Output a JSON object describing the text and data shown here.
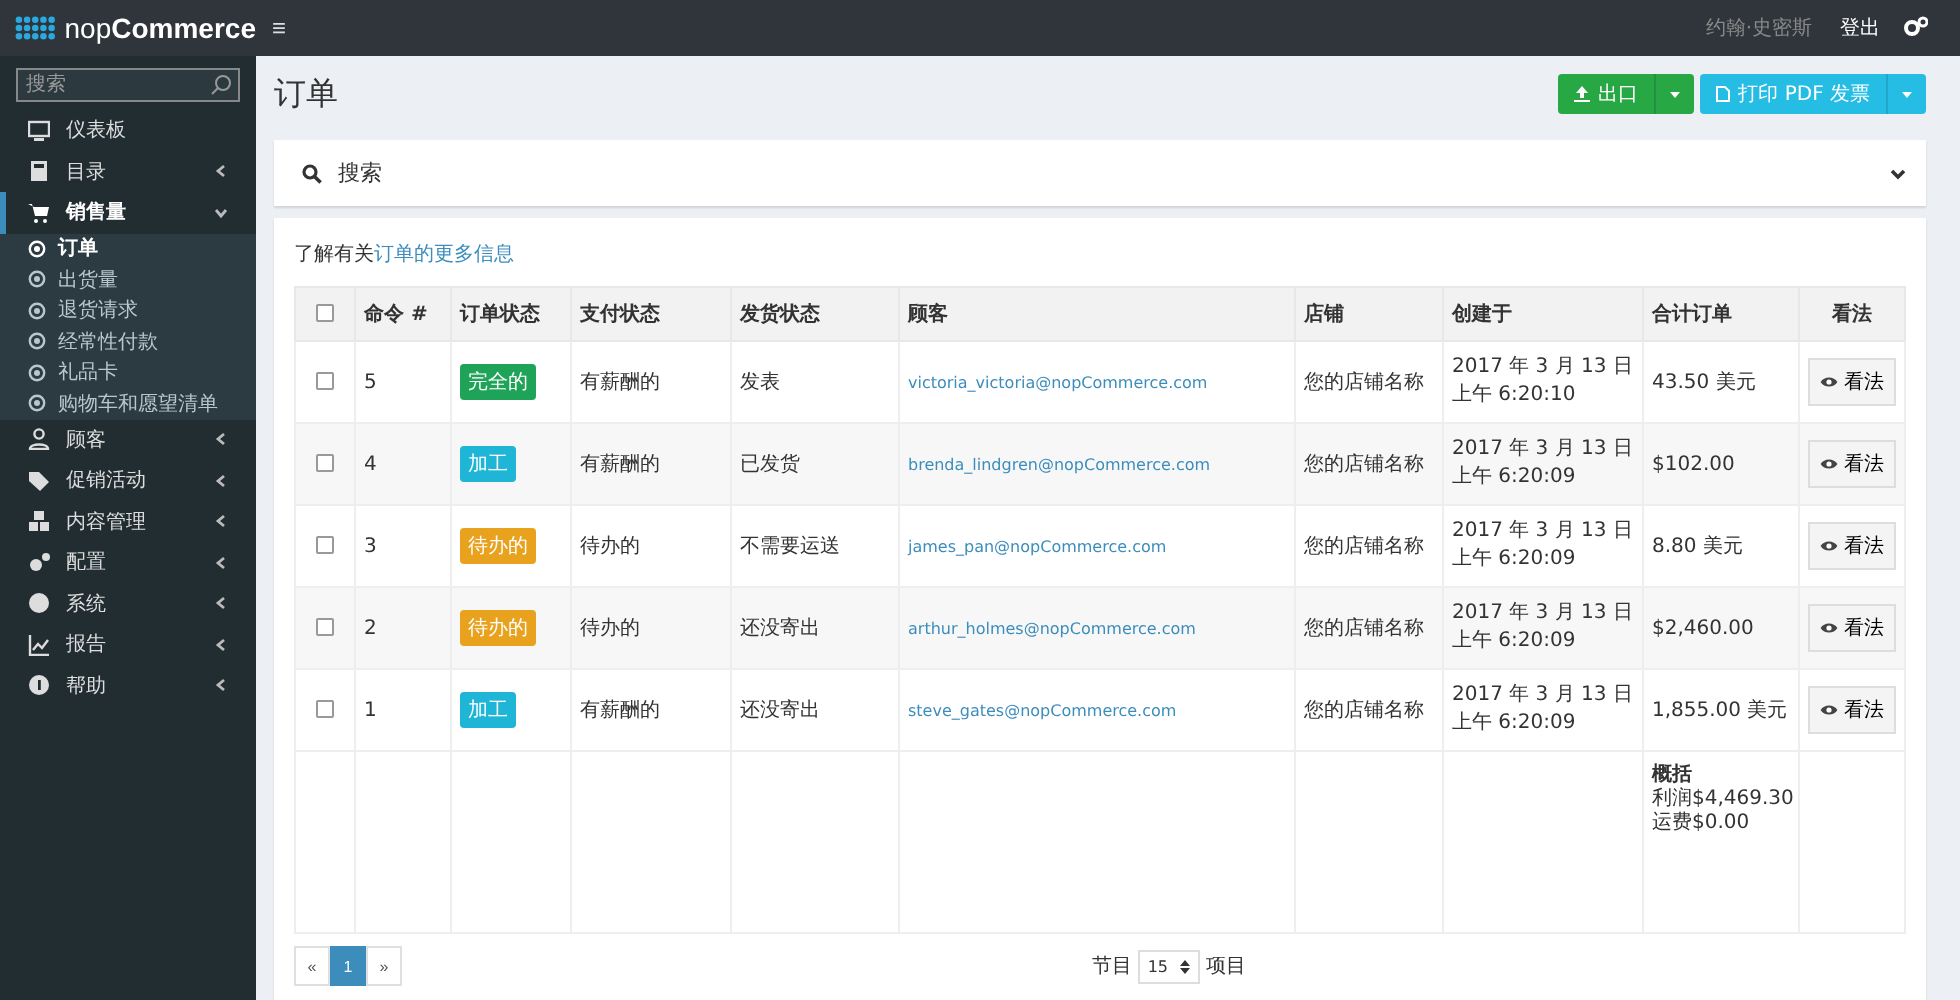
{
  "header": {
    "brand": "nop**Commerce**",
    "menu_glyph": "≡",
    "user": "约翰·史密斯",
    "logout": "登出"
  },
  "sidebar": {
    "search": {
      "placeholder": "搜索"
    },
    "items": [
      {
        "label": "仪表板",
        "has_arrow": false,
        "selected": false
      },
      {
        "label": "目录",
        "has_arrow": true,
        "expanded": false,
        "selected": false
      },
      {
        "label": "销售量",
        "has_arrow": true,
        "expanded": true,
        "selected": true,
        "children": [
          {
            "label": "订单",
            "selected": true
          },
          {
            "label": "出货量",
            "selected": false
          },
          {
            "label": "退货请求",
            "selected": false
          },
          {
            "label": "经常性付款",
            "selected": false
          },
          {
            "label": "礼品卡",
            "selected": false
          },
          {
            "label": "购物车和愿望清单",
            "selected": false
          }
        ]
      },
      {
        "label": "顾客",
        "has_arrow": true,
        "expanded": false,
        "selected": false
      },
      {
        "label": "促销活动",
        "has_arrow": true,
        "expanded": false,
        "selected": false
      },
      {
        "label": "内容管理",
        "has_arrow": true,
        "expanded": false,
        "selected": false
      },
      {
        "label": "配置",
        "has_arrow": true,
        "expanded": false,
        "selected": false
      },
      {
        "label": "系统",
        "has_arrow": true,
        "expanded": false,
        "selected": false
      },
      {
        "label": "报告",
        "has_arrow": true,
        "expanded": false,
        "selected": false
      },
      {
        "label": "帮助",
        "has_arrow": true,
        "expanded": false,
        "selected": false
      }
    ]
  },
  "page": {
    "title": "订单",
    "export_button": "出口",
    "print_button": "打印 PDF 发票"
  },
  "search_panel": {
    "label": "搜索",
    "expanded": false
  },
  "info": {
    "text": "了解有关",
    "link": "订单的更多信息"
  },
  "table": {
    "select_all_checked": false,
    "columns": [
      "命令 #",
      "订单状态",
      "支付状态",
      "发货状态",
      "顾客",
      "店铺",
      "创建于",
      "合计订单",
      "看法"
    ],
    "rows": [
      {
        "checked": false,
        "number": "5",
        "status": {
          "label": "完全的",
          "color": "#1fa358"
        },
        "payment": "有薪酬的",
        "shipping": "发表",
        "customer": "victoria_victoria@nopCommerce.com",
        "store": "您的店铺名称",
        "created_date": "2017 年 3 月 13 日",
        "created_time": "上午 6:20:10",
        "total": "43.50 美元",
        "view": "看法"
      },
      {
        "checked": false,
        "number": "4",
        "status": {
          "label": "加工",
          "color": "#1fb5d6"
        },
        "payment": "有薪酬的",
        "shipping": "已发货",
        "customer": "brenda_lindgren@nopCommerce.com",
        "store": "您的店铺名称",
        "created_date": "2017 年 3 月 13 日",
        "created_time": "上午 6:20:09",
        "total": "$102.00",
        "view": "看法"
      },
      {
        "checked": false,
        "number": "3",
        "status": {
          "label": "待办的",
          "color": "#e8a21e"
        },
        "payment": "待办的",
        "shipping": "不需要运送",
        "customer": "james_pan@nopCommerce.com",
        "store": "您的店铺名称",
        "created_date": "2017 年 3 月 13 日",
        "created_time": "上午 6:20:09",
        "total": "8.80 美元",
        "view": "看法"
      },
      {
        "checked": false,
        "number": "2",
        "status": {
          "label": "待办的",
          "color": "#e8a21e"
        },
        "payment": "待办的",
        "shipping": "还没寄出",
        "customer": "arthur_holmes@nopCommerce.com",
        "store": "您的店铺名称",
        "created_date": "2017 年 3 月 13 日",
        "created_time": "上午 6:20:09",
        "total": "$2,460.00",
        "view": "看法"
      },
      {
        "checked": false,
        "number": "1",
        "status": {
          "label": "加工",
          "color": "#1fb5d6"
        },
        "payment": "有薪酬的",
        "shipping": "还没寄出",
        "customer": "steve_gates@nopCommerce.com",
        "store": "您的店铺名称",
        "created_date": "2017 年 3 月 13 日",
        "created_time": "上午 6:20:09",
        "total": "1,855.00 美元",
        "view": "看法"
      }
    ],
    "summary": {
      "title": "概括",
      "profit": "利润$4,469.30",
      "shipping": "运费$0.00"
    }
  },
  "pagination": {
    "prev": "«",
    "pages": [
      {
        "label": "1",
        "selected": true
      }
    ],
    "next": "»",
    "size_label": "节目",
    "page_size": "15",
    "items_label": "项目"
  }
}
